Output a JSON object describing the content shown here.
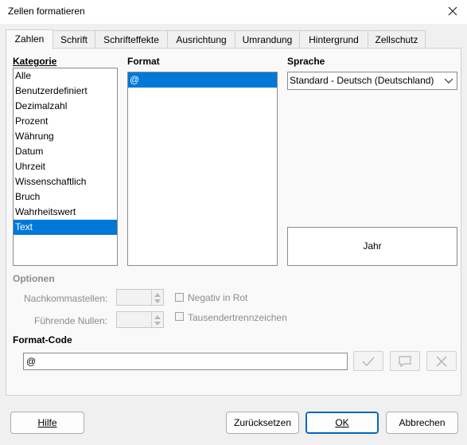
{
  "window": {
    "title": "Zellen formatieren"
  },
  "tabs": [
    {
      "label": "Zahlen",
      "active": true
    },
    {
      "label": "Schrift"
    },
    {
      "label": "Schrifteffekte"
    },
    {
      "label": "Ausrichtung"
    },
    {
      "label": "Umrandung"
    },
    {
      "label": "Hintergrund"
    },
    {
      "label": "Zellschutz"
    }
  ],
  "kategorie": {
    "label": "Kategorie",
    "items": [
      "Alle",
      "Benutzerdefiniert",
      "Dezimalzahl",
      "Prozent",
      "Währung",
      "Datum",
      "Uhrzeit",
      "Wissenschaftlich",
      "Bruch",
      "Wahrheitswert",
      "Text"
    ],
    "selected": "Text"
  },
  "format": {
    "label": "Format",
    "items": [
      "@"
    ],
    "selected": "@"
  },
  "sprache": {
    "label": "Sprache",
    "value": "Standard - Deutsch (Deutschland)"
  },
  "preview": {
    "text": "Jahr"
  },
  "optionen": {
    "label": "Optionen",
    "nachkommastellen": "Nachkommastellen:",
    "fuehrende_nullen": "Führende Nullen:",
    "negativ_in_rot": "Negativ in Rot",
    "tausendertrennzeichen": "Tausendertrennzeichen"
  },
  "format_code": {
    "label": "Format-Code",
    "value": "@"
  },
  "buttons": {
    "hilfe": "Hilfe",
    "zuruecksetzen": "Zurücksetzen",
    "ok": "OK",
    "abbrechen": "Abbrechen"
  }
}
